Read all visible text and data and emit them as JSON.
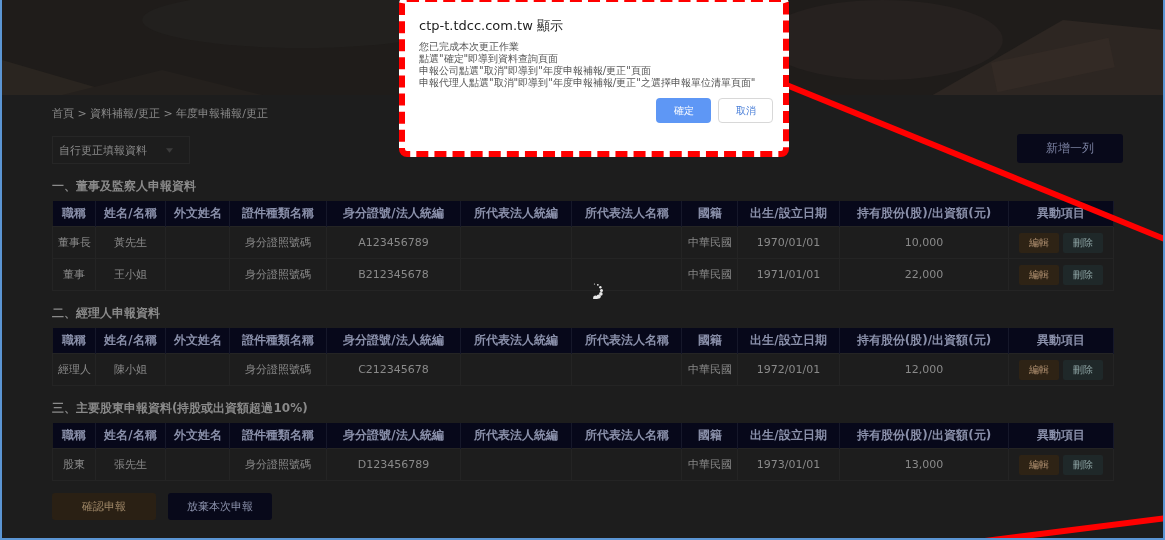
{
  "dialog": {
    "title": "ctp-t.tdcc.com.tw 顯示",
    "lines": [
      "您已完成本次更正作業",
      "點選\"確定\"即導到資料查詢頁面",
      "申報公司點選\"取消\"即導到\"年度申報補報/更正\"頁面",
      "申報代理人點選\"取消\"即導到\"年度申報補報/更正\"之選擇申報單位清單頁面\""
    ],
    "buttons": [
      {
        "label": "確定",
        "kind": "primary"
      },
      {
        "label": "取消",
        "kind": "secondary"
      }
    ]
  },
  "breadcrumb": "首頁 > 資料補報/更正 > 年度申報補報/更正",
  "filter_select": {
    "value": "自行更正填報資料"
  },
  "add_row_button": "新增一列",
  "sections": [
    {
      "title": "一、董事及監察人申報資料",
      "columns": [
        "職稱",
        "姓名/名稱",
        "外文姓名",
        "證件種類名稱",
        "身分證號/法人統編",
        "所代表法人統編",
        "所代表法人名稱",
        "國籍",
        "出生/設立日期",
        "持有股份(股)/出資額(元)",
        "異動項目"
      ],
      "rows": [
        {
          "title": "董事長",
          "name": "黃先生",
          "id_type": "身分證照號碼",
          "id_no": "A123456789",
          "nationality": "中華民國",
          "date": "1970/01/01",
          "shares": "10,000",
          "actions": [
            {
              "label": "編輯",
              "kind": "edit"
            },
            {
              "label": "刪除",
              "kind": "delete"
            }
          ]
        },
        {
          "title": "董事",
          "name": "王小姐",
          "id_type": "身分證照號碼",
          "id_no": "B212345678",
          "nationality": "中華民國",
          "date": "1971/01/01",
          "shares": "22,000",
          "actions": [
            {
              "label": "編輯",
              "kind": "edit"
            },
            {
              "label": "刪除",
              "kind": "delete"
            }
          ]
        }
      ]
    },
    {
      "title": "二、經理人申報資料",
      "columns": [
        "職稱",
        "姓名/名稱",
        "外文姓名",
        "證件種類名稱",
        "身分證號/法人統編",
        "所代表法人統編",
        "所代表法人名稱",
        "國籍",
        "出生/設立日期",
        "持有股份(股)/出資額(元)",
        "異動項目"
      ],
      "rows": [
        {
          "title": "經理人",
          "name": "陳小姐",
          "id_type": "身分證照號碼",
          "id_no": "C212345678",
          "nationality": "中華民國",
          "date": "1972/01/01",
          "shares": "12,000",
          "actions": [
            {
              "label": "編輯",
              "kind": "edit"
            },
            {
              "label": "刪除",
              "kind": "delete"
            }
          ]
        }
      ]
    },
    {
      "title": "三、主要股東申報資料(持股或出資額超過10%)",
      "columns": [
        "職稱",
        "姓名/名稱",
        "外文姓名",
        "證件種類名稱",
        "身分證號/法人統編",
        "所代表法人統編",
        "所代表法人名稱",
        "國籍",
        "出生/設立日期",
        "持有股份(股)/出資額(元)",
        "異動項目"
      ],
      "rows": [
        {
          "title": "股東",
          "name": "張先生",
          "id_type": "身分證照號碼",
          "id_no": "D123456789",
          "nationality": "中華民國",
          "date": "1973/01/01",
          "shares": "13,000",
          "actions": [
            {
              "label": "編輯",
              "kind": "edit"
            },
            {
              "label": "刪除",
              "kind": "delete"
            }
          ]
        }
      ]
    }
  ],
  "footer_buttons": [
    {
      "label": "確認申報",
      "kind": "confirm"
    },
    {
      "label": "放棄本次申報",
      "kind": "cancel"
    }
  ]
}
